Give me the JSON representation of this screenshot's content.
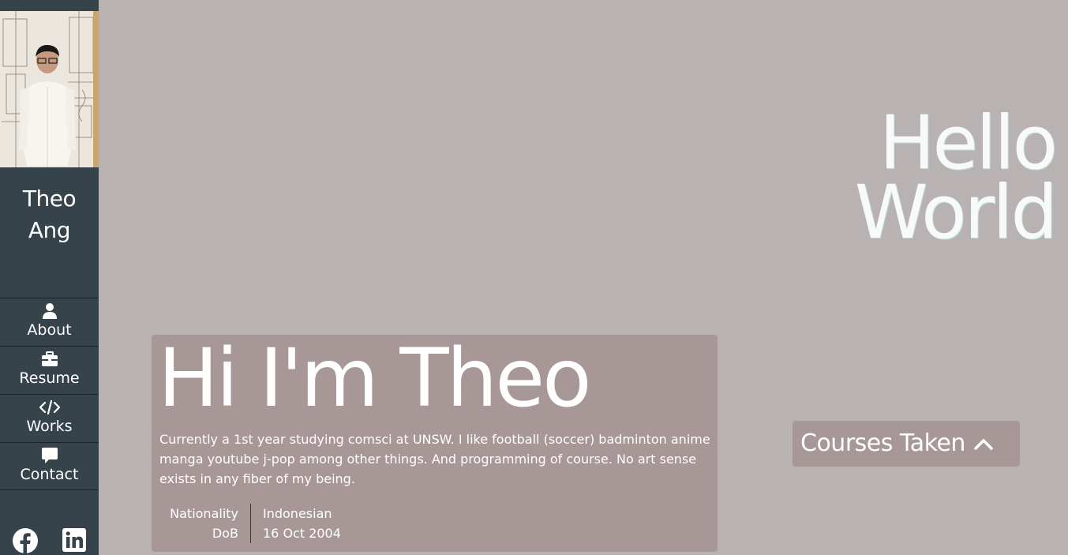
{
  "sidebar": {
    "photo_alt": "Theo Ang",
    "name_line1": "Theo",
    "name_line2": "Ang",
    "nav": [
      {
        "label": "About",
        "icon": "user-icon"
      },
      {
        "label": "Resume",
        "icon": "briefcase-icon"
      },
      {
        "label": "Works",
        "icon": "code-icon"
      },
      {
        "label": "Contact",
        "icon": "comment-icon"
      }
    ],
    "social": [
      "facebook-icon",
      "linkedin-icon"
    ]
  },
  "hero": {
    "line1": "Hello",
    "line2": "World"
  },
  "intro": {
    "title": "Hi I'm Theo",
    "description": "Currently a 1st year studying comsci at UNSW. I like football (soccer) badminton anime manga youtube j-pop among other things. And programming of course. No art sense exists in any fiber of my being.",
    "facts": [
      {
        "key": "Nationality",
        "value": "Indonesian"
      },
      {
        "key": "DoB",
        "value": "16 Oct 2004"
      }
    ]
  },
  "courses": {
    "label": "Courses Taken"
  },
  "colors": {
    "background": "#b8b2b2",
    "sidebar": "#36434b",
    "card": "#a79797",
    "text": "#ffffff"
  }
}
